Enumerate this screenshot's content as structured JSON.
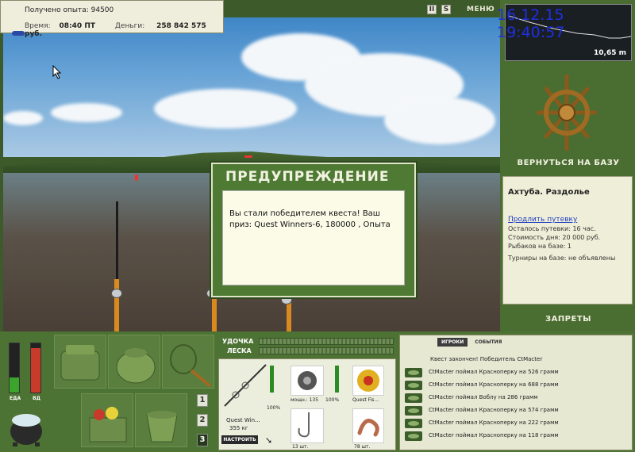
{
  "info": {
    "exp_label": "Получено опыта:",
    "exp_value": "94500",
    "time_label": "Время:",
    "time_value": "08:40 ПТ",
    "money_label": "Деньги:",
    "money_value": "258 842 575 руб."
  },
  "toolbar": {
    "pause_label": "II",
    "sound_label": "S",
    "menu_label": "МЕНЮ"
  },
  "datetime": "16.12.15 19:40:57",
  "depth": "10,65 m",
  "right": {
    "return_label": "ВЕРНУТЬСЯ НА БАЗУ",
    "location": "Ахтуба. Раздолье",
    "extend_link": "Продлить путевку",
    "left_line": "Осталось путевки: 16 час.",
    "cost_line": "Стоимость дня: 20 000 руб.",
    "fishers_line": "Рыбаков на базе: 1",
    "tourn_line": "Турниры на базе: не объявлены",
    "bans_label": "ЗАПРЕТЫ"
  },
  "meters": {
    "food_label": "ЕДА",
    "food_level": 0.3,
    "water_label": "ВД",
    "water_level": 0.9
  },
  "slots": [
    "1",
    "2",
    "3"
  ],
  "gauges": {
    "rod_label": "УДОЧКА",
    "line_label": "ЛЕСКА"
  },
  "tackle": {
    "rod_name": "Quest Win...",
    "rod_weight": "355 кг",
    "rod_pct": "100%",
    "reel_power": "мощн.: 135",
    "reel_pct": "100%",
    "line_name": "Quest Fis...",
    "hook_count": "13 шт.",
    "bait_count": "78 шт.",
    "adjust_label": "НАСТРОИТЬ"
  },
  "feed": {
    "tabs": [
      "ИГРОКИ",
      "СОБЫТИЯ"
    ],
    "header": "Квест закончен! Победитель CtMacter",
    "rows": [
      "CtMacter поймал Красноперку на 526 грамм",
      "CtMacter поймал Красноперку на 688 грамм",
      "CtMacter поймал Воблу на 286 грамм",
      "CtMacter поймал Красноперку на 574 грамм",
      "CtMacter поймал Красноперку на 222 грамм",
      "CtMacter поймал Красноперку на 118 грамм"
    ]
  },
  "modal": {
    "title": "ПРЕДУПРЕЖДЕНИЕ",
    "message": "Вы стали победителем квеста! Ваш приз: Quest Winners-6, 180000 , Опыта"
  },
  "colors": {
    "panel_green": "#4a6d31",
    "datetime_blue": "#1f2fe0",
    "food_red": "#c83a2a",
    "water_green": "#3aa52a"
  }
}
